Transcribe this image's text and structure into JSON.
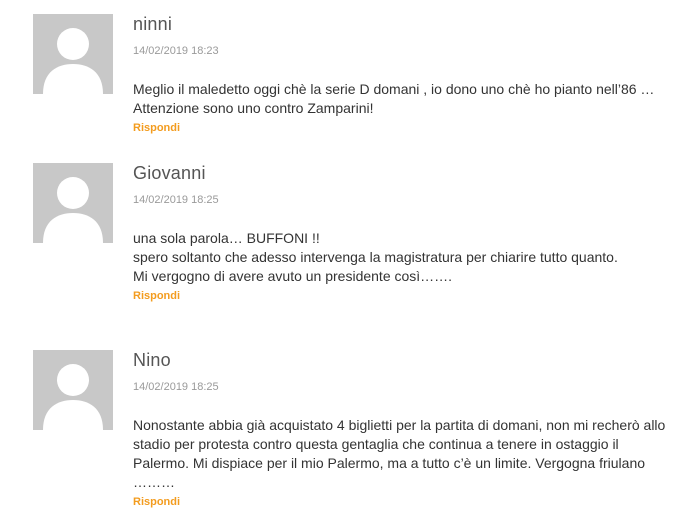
{
  "comments": [
    {
      "author": "ninni",
      "date": "14/02/2019 18:23",
      "lines": [
        "Meglio il maledetto oggi chè la serie D domani , io dono uno chè ho pianto nell’86 … Attenzione sono uno contro Zamparini!"
      ],
      "reply_label": "Rispondi",
      "avatar_icon": "default-user-avatar-icon"
    },
    {
      "author": "Giovanni",
      "date": "14/02/2019 18:25",
      "lines": [
        "una sola parola… BUFFONI !!",
        "spero soltanto che adesso intervenga la magistratura per chiarire tutto quanto.",
        "Mi vergogno di avere avuto un presidente così……."
      ],
      "reply_label": "Rispondi",
      "avatar_icon": "default-user-avatar-icon"
    },
    {
      "author": "Nino",
      "date": "14/02/2019 18:25",
      "lines": [
        "Nonostante abbia già acquistato 4 biglietti per la partita di domani, non mi recherò allo stadio per protesta contro questa gentaglia che continua a tenere in ostaggio il Palermo. Mi dispiace per il mio Palermo, ma a tutto c’è un limite. Vergogna friulano ………"
      ],
      "reply_label": "Rispondi",
      "avatar_icon": "default-user-avatar-icon"
    }
  ],
  "colors": {
    "avatar_bg": "#c8c8c8",
    "reply_accent": "#f39c1f",
    "date_gray": "#9a9a9a"
  }
}
